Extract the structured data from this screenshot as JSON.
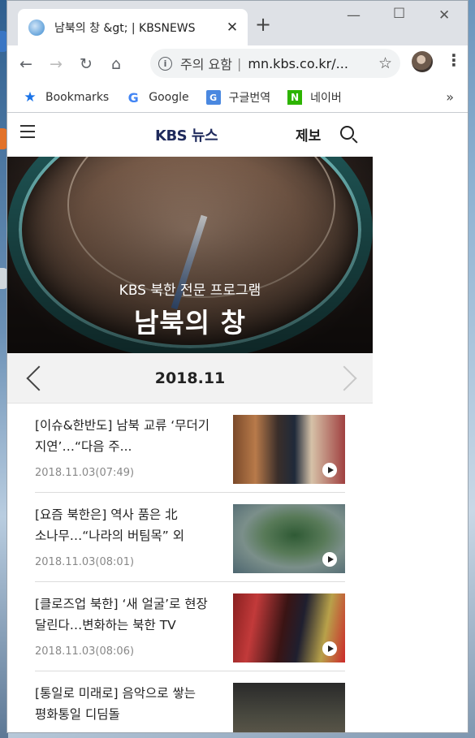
{
  "browser": {
    "tab_title": "남북의 창 &gt; | KBSNEWS",
    "omnibox": {
      "security_warning": "주의 요함",
      "separator": "|",
      "url": "mn.kbs.co.kr/..."
    },
    "bookmarks": [
      {
        "label": "Bookmarks",
        "icon": "star-icon",
        "color": "#1a73e8"
      },
      {
        "label": "Google",
        "icon": "google-icon",
        "color": "#4285f4"
      },
      {
        "label": "구글번역",
        "icon": "translate-icon",
        "color": "#4a88e0"
      },
      {
        "label": "네이버",
        "icon": "naver-icon",
        "color": "#2db400"
      }
    ],
    "bookmarks_more": "»"
  },
  "site": {
    "logo_brand": "KBS",
    "logo_suffix": "뉴스",
    "report_label": "제보"
  },
  "hero": {
    "subtitle": "KBS 북한 전문 프로그램",
    "title": "남북의 창"
  },
  "month": {
    "label": "2018.11"
  },
  "news": [
    {
      "title": "[이슈&한반도] 남북 교류 ‘무더기 지연’…“다음 주...",
      "date": "2018.11.03(07:49)"
    },
    {
      "title": "[요즘 북한은] 역사 품은 北 소나무…“나라의 버팀목” 외",
      "date": "2018.11.03(08:01)"
    },
    {
      "title": "[클로즈업 북한] ‘새 얼굴’로 현장 달린다…변화하는 북한 TV",
      "date": "2018.11.03(08:06)"
    },
    {
      "title": "[통일로 미래로] 음악으로 쌓는 평화통일 디딤돌",
      "date": ""
    }
  ]
}
